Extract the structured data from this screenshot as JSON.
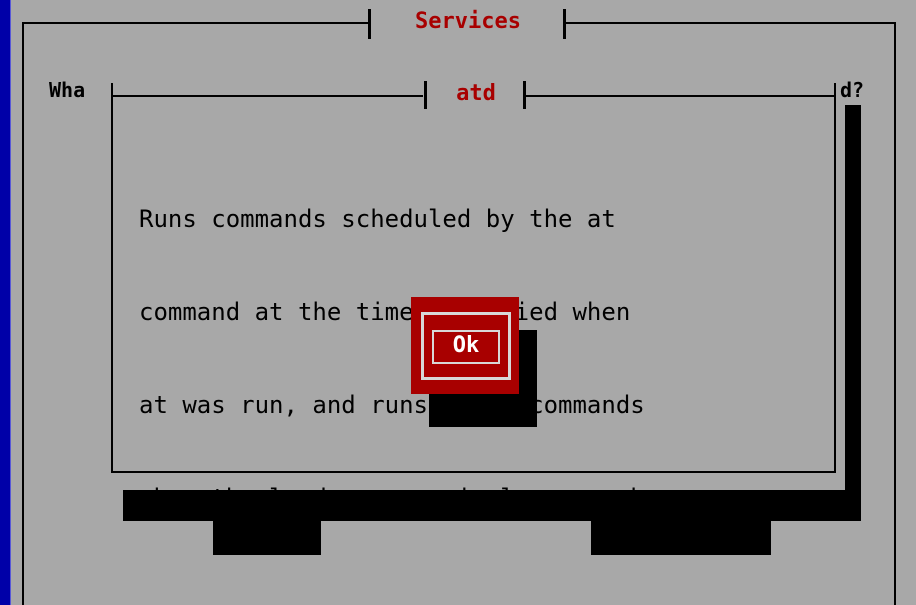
{
  "screen": {
    "colors": {
      "background": "#0000a8",
      "window": "#a8a8a8",
      "accent": "#a80000",
      "text": "#000000",
      "shadow": "#000000"
    }
  },
  "window": {
    "title": "Services",
    "prompt_left": "Wha",
    "prompt_right": "d?"
  },
  "dialog": {
    "title": "atd",
    "message_lines": [
      "Runs commands scheduled by the at",
      "command at the time specified when",
      "at was run, and runs batch commands",
      "when the load average is low enough."
    ],
    "ok_label": "Ok"
  }
}
